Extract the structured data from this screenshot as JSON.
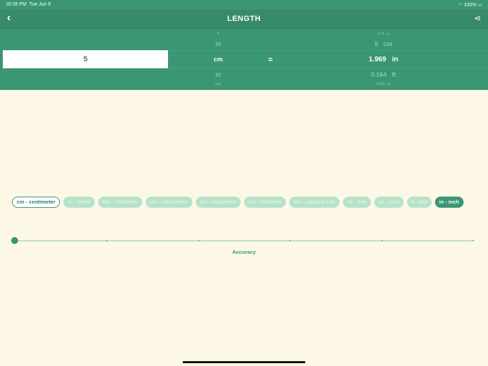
{
  "status": {
    "time": "10:28 PM",
    "date": "Tue Jun 9",
    "battery": "100%"
  },
  "header": {
    "title": "LENGTH",
    "back_icon": "chevron-left-icon",
    "share_icon": "share-icon"
  },
  "picker": {
    "units_left": [
      "ft",
      "in",
      "cm",
      "m",
      "mm"
    ],
    "input_value": "5",
    "equals": "=",
    "results": [
      {
        "value": "0.05",
        "unit": "m"
      },
      {
        "value": "5",
        "unit": "cm"
      },
      {
        "value": "1.969",
        "unit": "in"
      },
      {
        "value": "0.164",
        "unit": "ft"
      },
      {
        "value": "0.055",
        "unit": "yd"
      }
    ]
  },
  "chips": [
    "cm - centimeter",
    "m - meter",
    "mm - millimeter",
    "µm - micrometer",
    "nm - nanometer",
    "km - kilometer",
    "nmi - nautical mile",
    "mi - mile",
    "yd - yard",
    "ft - foot",
    "in - inch"
  ],
  "slider": {
    "label": "Accuracy",
    "value": 0
  }
}
